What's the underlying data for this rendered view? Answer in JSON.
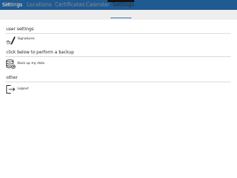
{
  "window": {
    "title": "Settings"
  },
  "tabs": [
    {
      "label": "Clients"
    },
    {
      "label": "Locations"
    },
    {
      "label": "Certificates"
    },
    {
      "label": "Calendar"
    },
    {
      "label": "Settings",
      "active": true
    }
  ],
  "sections": {
    "user_settings": {
      "title": "user settings",
      "item": {
        "label": "Signatures",
        "icon": "signature-pen-icon"
      }
    },
    "backup": {
      "title": "click below to perform a backup",
      "item": {
        "label": "Back up my data",
        "icon": "database-backup-icon"
      }
    },
    "other": {
      "title": "other",
      "item": {
        "label": "Logout",
        "icon": "logout-icon"
      }
    }
  },
  "colors": {
    "title_bar": "#1f5a93",
    "tab_bar": "#eeeeee",
    "active_tab_underline": "#2b6db3"
  }
}
